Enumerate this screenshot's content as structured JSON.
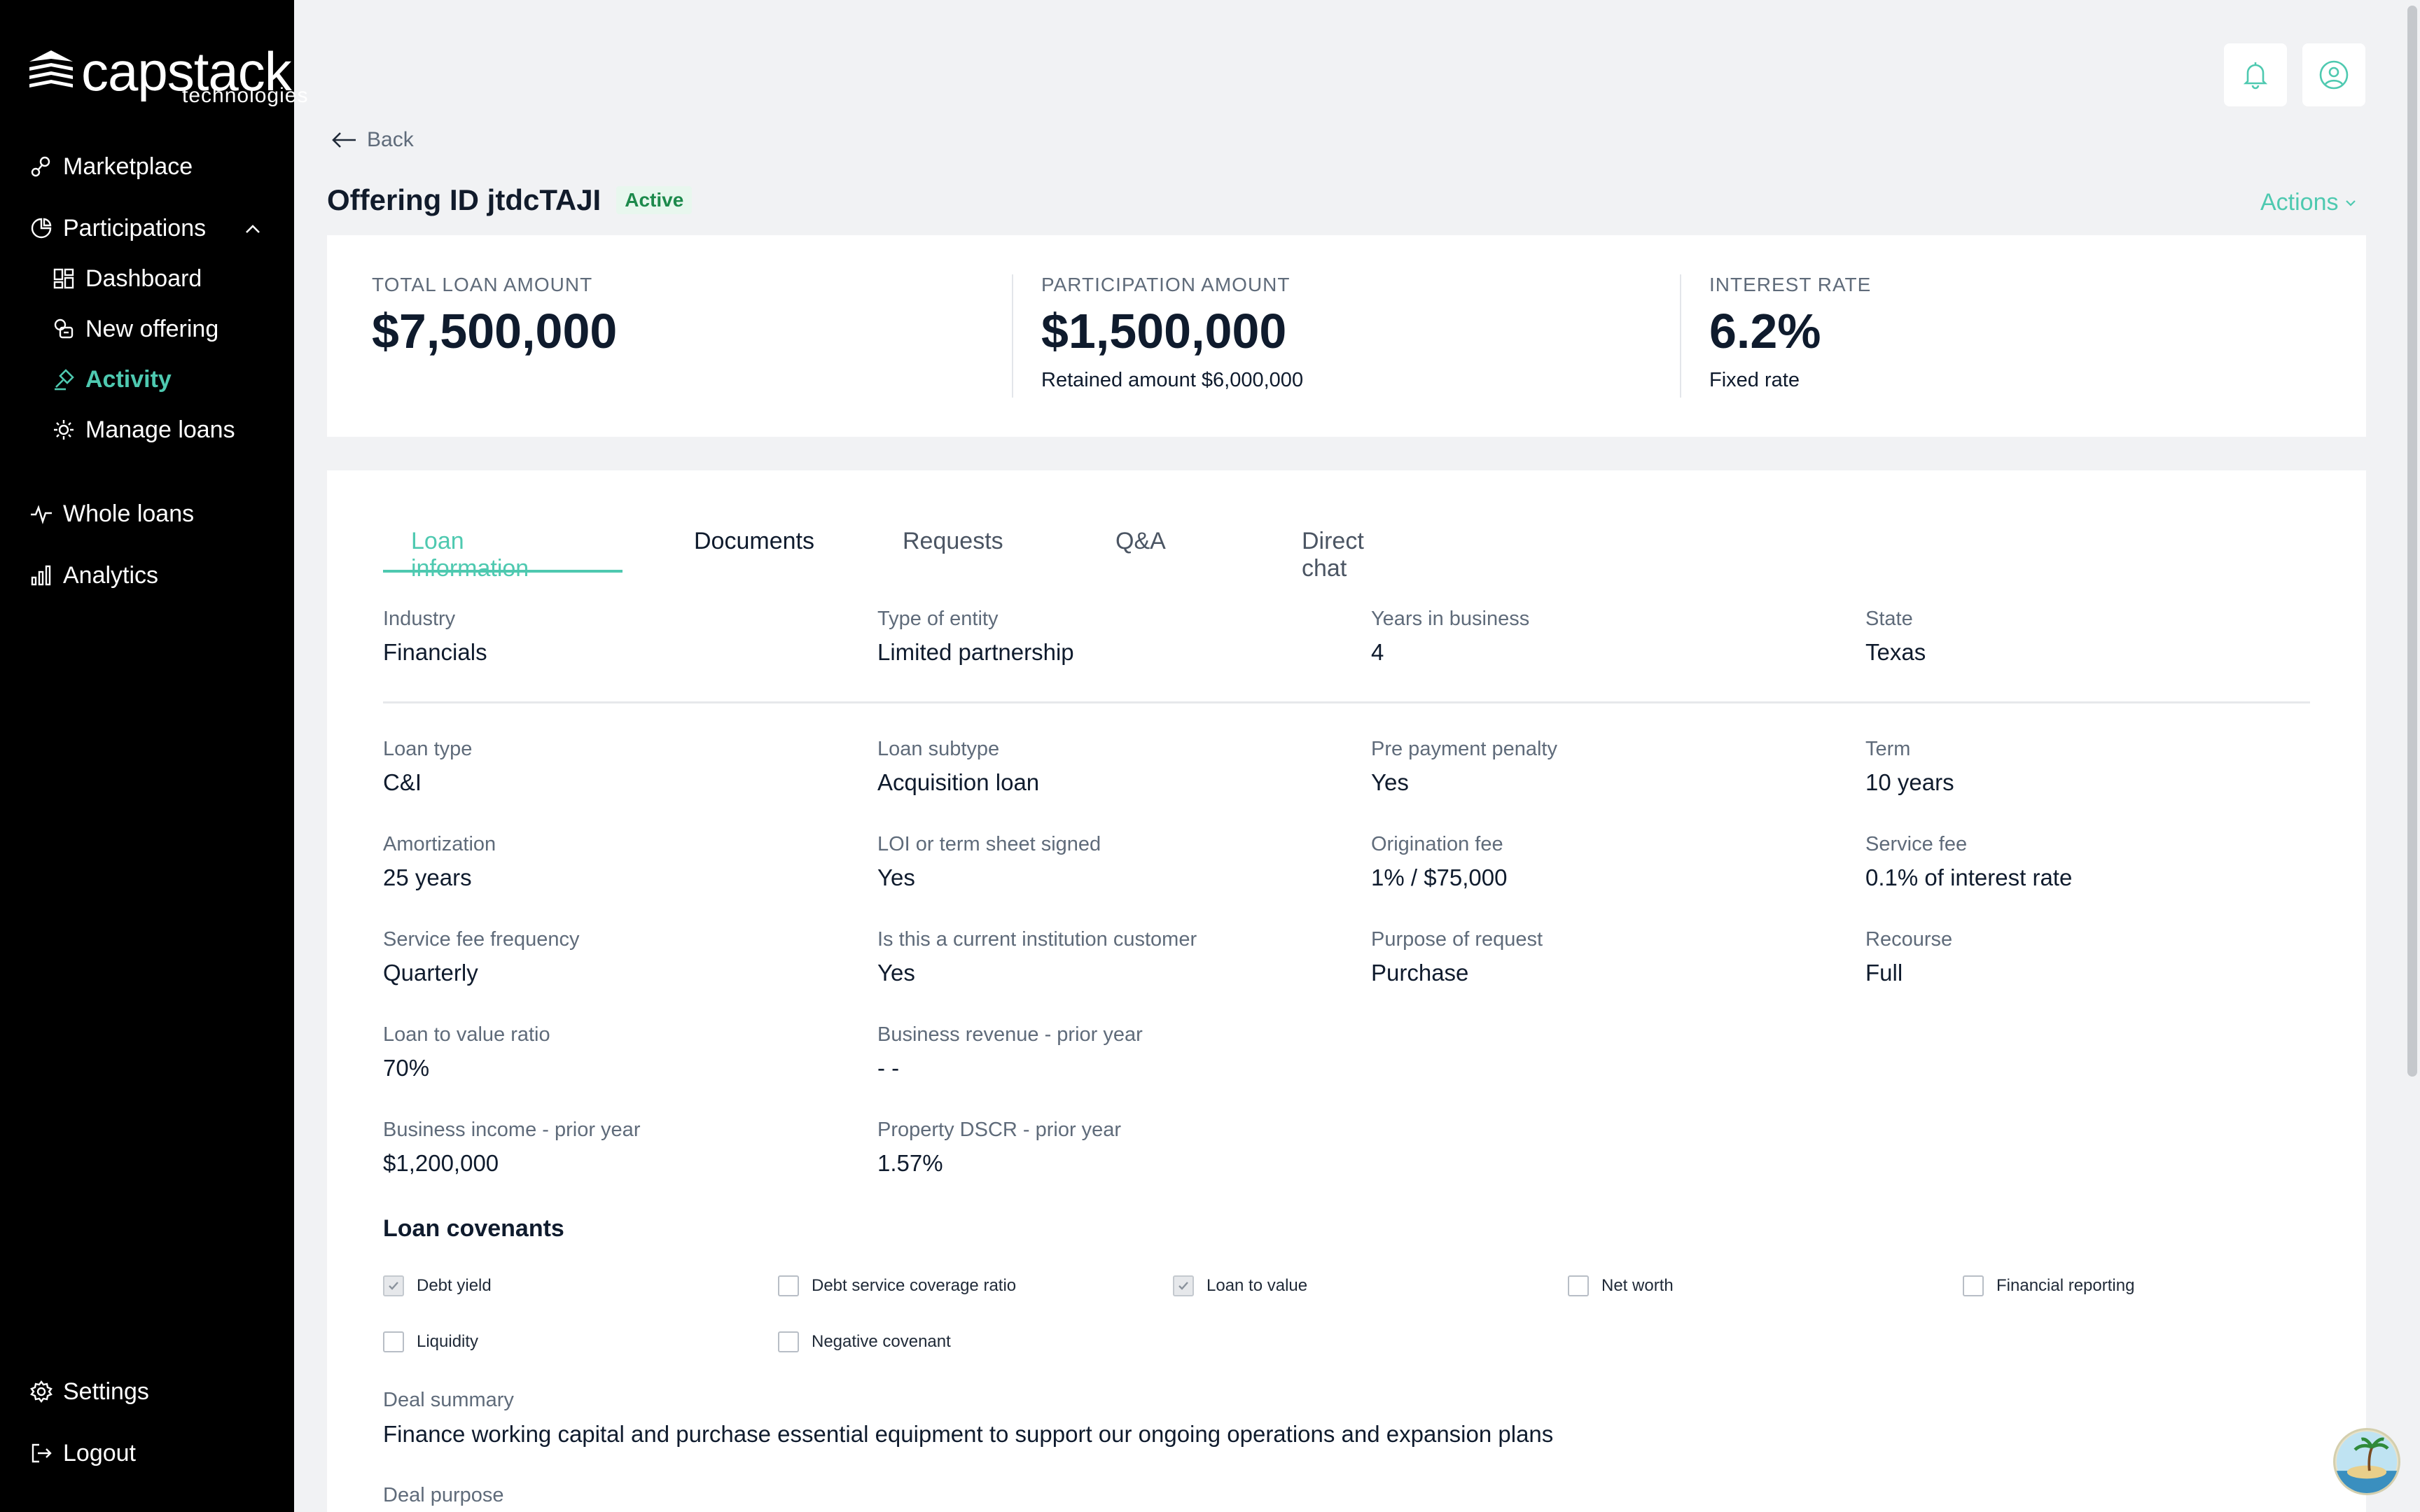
{
  "brand": {
    "name": "capstack",
    "tagline": "technologies"
  },
  "sidebar": {
    "items": [
      {
        "label": "Marketplace",
        "icon": "marketplace-icon"
      },
      {
        "label": "Participations",
        "icon": "pie-chart-icon"
      },
      {
        "label": "Dashboard",
        "icon": "dashboard-icon"
      },
      {
        "label": "New offering",
        "icon": "new-offering-icon"
      },
      {
        "label": "Activity",
        "icon": "activity-icon"
      },
      {
        "label": "Manage loans",
        "icon": "manage-loans-icon"
      },
      {
        "label": "Whole loans",
        "icon": "pulse-icon"
      },
      {
        "label": "Analytics",
        "icon": "bar-chart-icon"
      }
    ],
    "settings": "Settings",
    "logout": "Logout"
  },
  "header": {
    "back": "Back",
    "title": "Offering ID jtdcTAJI",
    "status": "Active",
    "actions": "Actions"
  },
  "stats": [
    {
      "label": "TOTAL LOAN AMOUNT",
      "value": "$7,500,000",
      "sub": ""
    },
    {
      "label": "PARTICIPATION AMOUNT",
      "value": "$1,500,000",
      "sub": "Retained amount $6,000,000"
    },
    {
      "label": "INTEREST RATE",
      "value": "6.2%",
      "sub": "Fixed rate"
    }
  ],
  "tabs": [
    "Loan information",
    "Documents",
    "Requests",
    "Q&A",
    "Direct chat"
  ],
  "entity": [
    {
      "k": "Industry",
      "v": "Financials"
    },
    {
      "k": "Type of entity",
      "v": "Limited partnership"
    },
    {
      "k": "Years in business",
      "v": "4"
    },
    {
      "k": "State",
      "v": "Texas"
    }
  ],
  "loan": [
    {
      "k": "Loan type",
      "v": "C&I"
    },
    {
      "k": "Loan subtype",
      "v": "Acquisition loan"
    },
    {
      "k": "Pre payment penalty",
      "v": "Yes"
    },
    {
      "k": "Term",
      "v": "10 years"
    },
    {
      "k": "Amortization",
      "v": "25 years"
    },
    {
      "k": "LOI or term sheet signed",
      "v": "Yes"
    },
    {
      "k": "Origination fee",
      "v": "1% / $75,000"
    },
    {
      "k": "Service fee",
      "v": "0.1% of interest rate"
    },
    {
      "k": "Service fee frequency",
      "v": "Quarterly"
    },
    {
      "k": "Is this a current institution customer",
      "v": "Yes"
    },
    {
      "k": "Purpose of request",
      "v": "Purchase"
    },
    {
      "k": "Recourse",
      "v": "Full"
    },
    {
      "k": "Loan to value ratio",
      "v": "70%"
    },
    {
      "k": "Business revenue - prior year",
      "v": "- -"
    },
    {
      "k": "Business income - prior year",
      "v": "$1,200,000"
    },
    {
      "k": "Property DSCR - prior year",
      "v": "1.57%"
    }
  ],
  "covenants": {
    "title": "Loan covenants",
    "items": [
      {
        "label": "Debt yield",
        "checked": true
      },
      {
        "label": "Debt service coverage ratio",
        "checked": false
      },
      {
        "label": "Loan to value",
        "checked": true
      },
      {
        "label": "Net worth",
        "checked": false
      },
      {
        "label": "Financial reporting",
        "checked": false
      },
      {
        "label": "Liquidity",
        "checked": false
      },
      {
        "label": "Negative covenant",
        "checked": false
      }
    ]
  },
  "deal": {
    "summary_label": "Deal summary",
    "summary": "Finance working capital and purchase essential equipment to support our ongoing operations and expansion plans",
    "purpose_label": "Deal purpose"
  },
  "colors": {
    "accent": "#4ec9b0",
    "sidebar": "#000000",
    "background": "#f1f2f4"
  }
}
